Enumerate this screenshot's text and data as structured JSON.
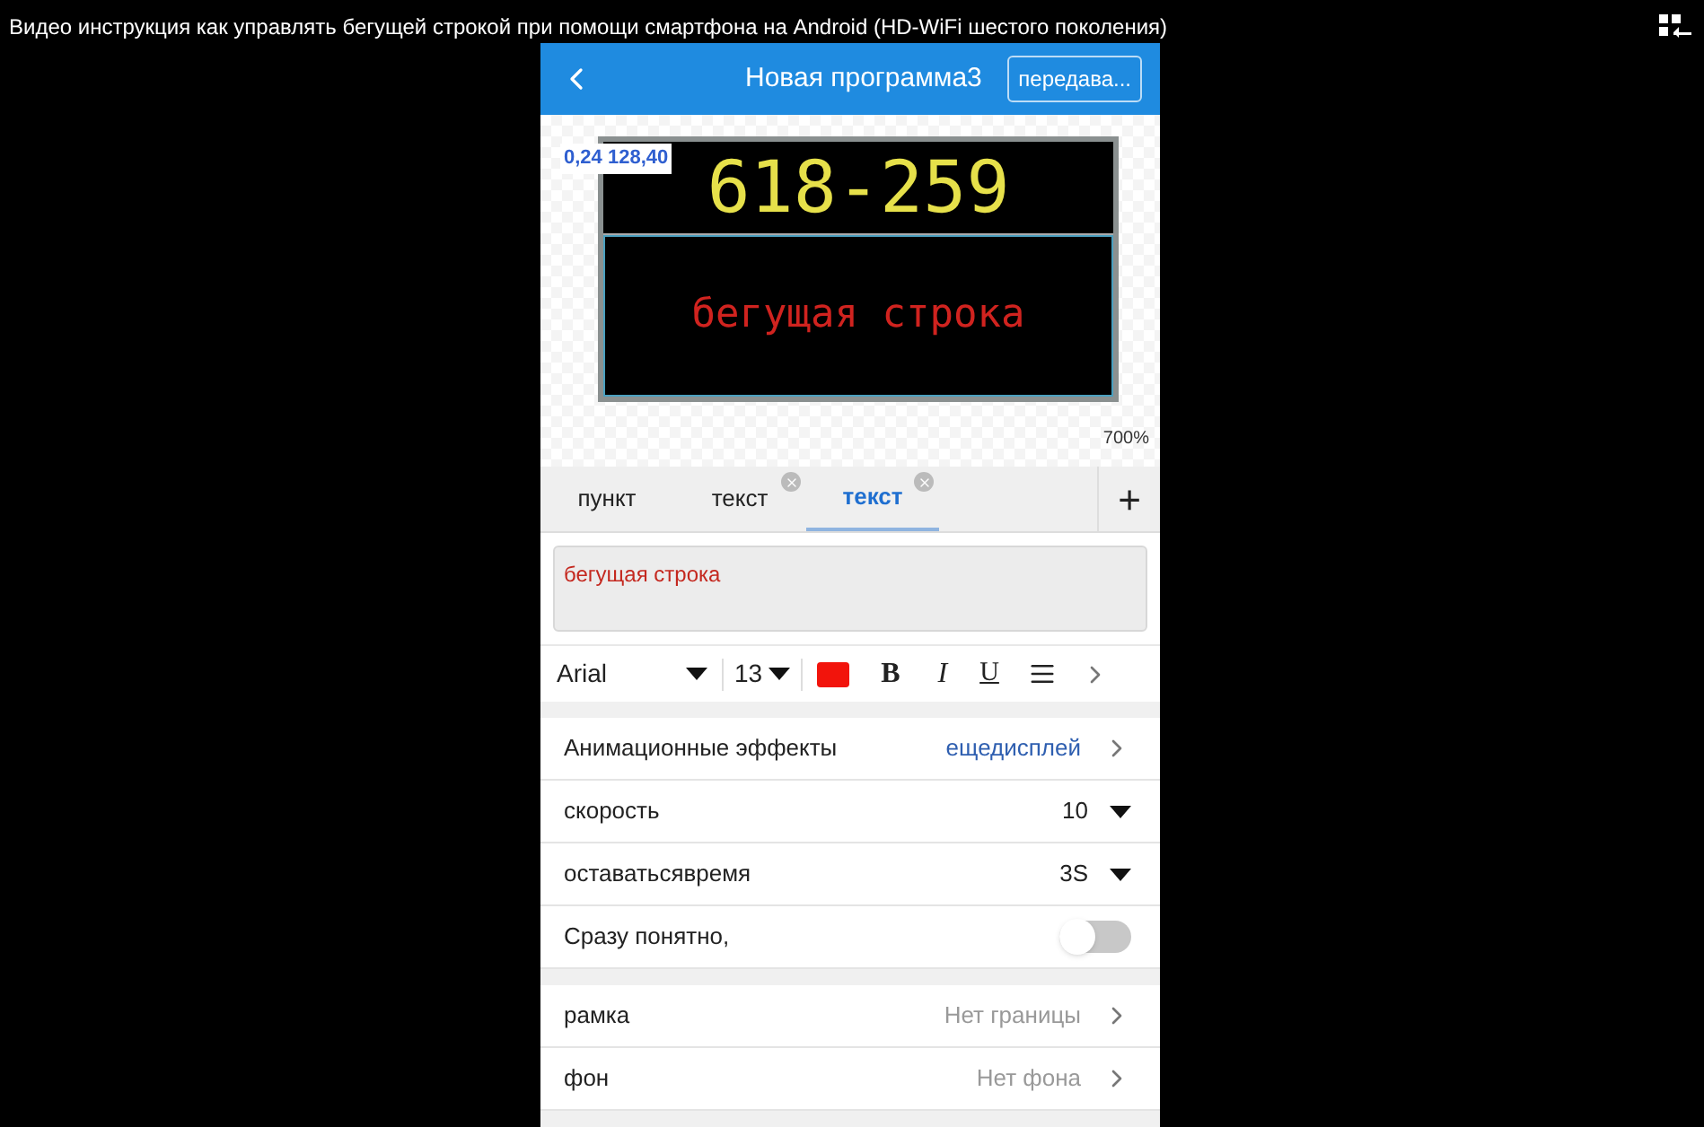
{
  "video_title": "Видео инструкция как управлять бегущей строкой при помощи смартфона на Android (HD-WiFi шестого поколения)",
  "header": {
    "title": "Новая программа3",
    "action": "передава..."
  },
  "preview": {
    "coords": "0,24 128,40",
    "zoom": "700%",
    "zones": [
      {
        "text": "618-259",
        "color": "#e6e04a",
        "selected": false
      },
      {
        "text": "бегущая строка",
        "color": "#d0231f",
        "selected": true
      }
    ]
  },
  "tabs": [
    {
      "label": "пункт",
      "selected": false,
      "closable": false
    },
    {
      "label": "текст",
      "selected": false,
      "closable": true
    },
    {
      "label": "текст",
      "selected": true,
      "closable": true
    }
  ],
  "add_tab": "+",
  "text_field": {
    "value": "бегущая строка"
  },
  "toolbar": {
    "font": "Arial",
    "size": "13",
    "color": "#f2140c",
    "bold": "B",
    "italic": "I",
    "underline": "U"
  },
  "settings": [
    {
      "kind": "link",
      "label": "Анимационные эффекты",
      "value": "ещедисплей",
      "accent": true
    },
    {
      "kind": "dropdown",
      "label": "скорость",
      "value": "10"
    },
    {
      "kind": "dropdown",
      "label": "оставатьсявремя",
      "value": "3S"
    },
    {
      "kind": "toggle",
      "label": "Сразу понятно,",
      "on": false
    }
  ],
  "settings2": [
    {
      "kind": "link",
      "label": "рамка",
      "value": "Нет границы",
      "accent": false
    },
    {
      "kind": "link",
      "label": "фон",
      "value": "Нет фона",
      "accent": false
    }
  ]
}
